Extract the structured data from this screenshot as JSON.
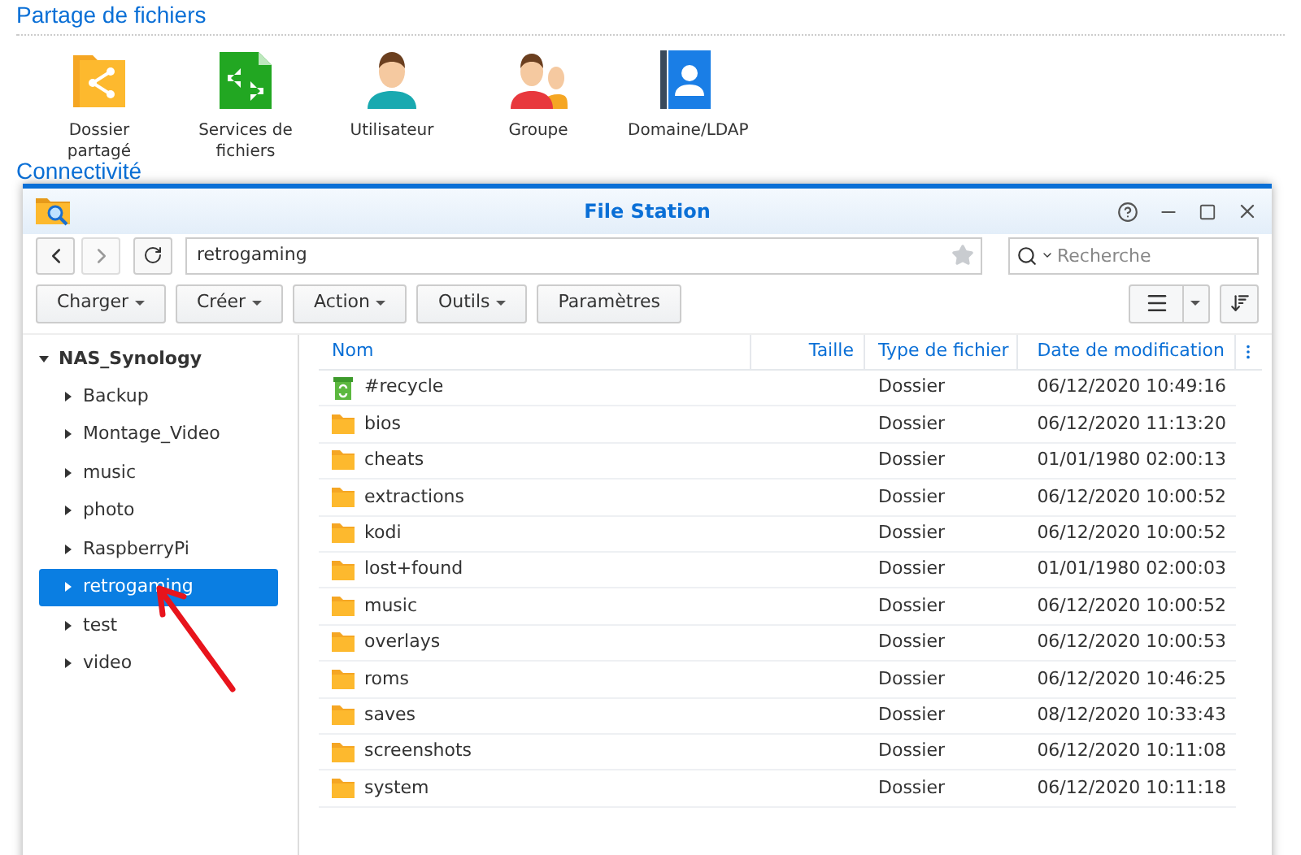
{
  "background": {
    "section_title": "Partage de fichiers",
    "apps": [
      {
        "label": "Dossier partagé",
        "kind": "shared-folder"
      },
      {
        "label": "Services de fichiers",
        "kind": "file-services"
      },
      {
        "label": "Utilisateur",
        "kind": "user"
      },
      {
        "label": "Groupe",
        "kind": "group"
      },
      {
        "label": "Domaine/LDAP",
        "kind": "directory"
      }
    ],
    "next_section_title": "Connectivité"
  },
  "window": {
    "title": "File Station",
    "path": "retrogaming",
    "path_starred": false,
    "search": {
      "placeholder": "Recherche"
    },
    "toolbar": [
      {
        "label": "Charger",
        "dropdown": true
      },
      {
        "label": "Créer",
        "dropdown": true
      },
      {
        "label": "Action",
        "dropdown": true
      },
      {
        "label": "Outils",
        "dropdown": true
      },
      {
        "label": "Paramètres",
        "dropdown": false
      }
    ],
    "tree": {
      "label": "NAS_Synology",
      "expanded": true,
      "children": [
        {
          "label": "Backup",
          "expanded": false,
          "selected": false
        },
        {
          "label": "Montage_Video",
          "expanded": false,
          "selected": false
        },
        {
          "label": "music",
          "expanded": false,
          "selected": false
        },
        {
          "label": "photo",
          "expanded": false,
          "selected": false
        },
        {
          "label": "RaspberryPi",
          "expanded": false,
          "selected": false
        },
        {
          "label": "retrogaming",
          "expanded": false,
          "selected": true
        },
        {
          "label": "test",
          "expanded": false,
          "selected": false
        },
        {
          "label": "video",
          "expanded": false,
          "selected": false
        }
      ]
    },
    "table": {
      "columns": [
        "Nom",
        "Taille",
        "Type de fichier",
        "Date de modification"
      ],
      "rows": [
        {
          "kind": "recycle",
          "name": "#recycle",
          "type": "Dossier",
          "modified": "06/12/2020 10:49:16"
        },
        {
          "kind": "folder",
          "name": "bios",
          "type": "Dossier",
          "modified": "06/12/2020 11:13:20"
        },
        {
          "kind": "folder",
          "name": "cheats",
          "type": "Dossier",
          "modified": "01/01/1980 02:00:13"
        },
        {
          "kind": "folder",
          "name": "extractions",
          "type": "Dossier",
          "modified": "06/12/2020 10:00:52"
        },
        {
          "kind": "folder",
          "name": "kodi",
          "type": "Dossier",
          "modified": "06/12/2020 10:00:52"
        },
        {
          "kind": "folder",
          "name": "lost+found",
          "type": "Dossier",
          "modified": "01/01/1980 02:00:03"
        },
        {
          "kind": "folder",
          "name": "music",
          "type": "Dossier",
          "modified": "06/12/2020 10:00:52"
        },
        {
          "kind": "folder",
          "name": "overlays",
          "type": "Dossier",
          "modified": "06/12/2020 10:00:53"
        },
        {
          "kind": "folder",
          "name": "roms",
          "type": "Dossier",
          "modified": "06/12/2020 10:46:25"
        },
        {
          "kind": "folder",
          "name": "saves",
          "type": "Dossier",
          "modified": "08/12/2020 10:33:43"
        },
        {
          "kind": "folder",
          "name": "screenshots",
          "type": "Dossier",
          "modified": "06/12/2020 10:11:08"
        },
        {
          "kind": "folder",
          "name": "system",
          "type": "Dossier",
          "modified": "06/12/2020 10:11:18"
        }
      ]
    }
  }
}
